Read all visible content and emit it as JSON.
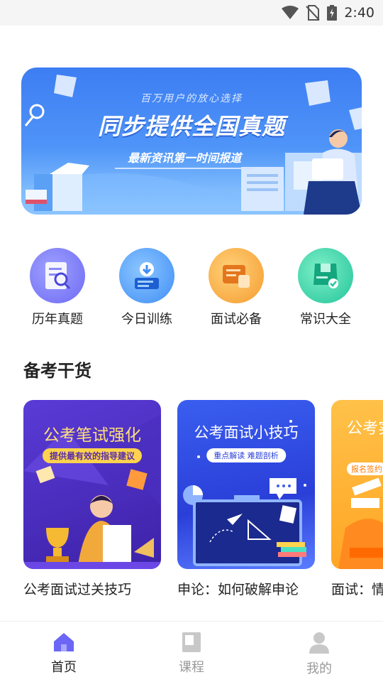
{
  "status_bar": {
    "time": "2:40"
  },
  "banner": {
    "subtitle": "百万用户的放心选择",
    "title": "同步提供全国真题",
    "tagline": "最新资讯第一时间报道"
  },
  "quick_menu": [
    {
      "label": "历年真题",
      "icon": "past-exams-icon",
      "color": "#6f6cf6"
    },
    {
      "label": "今日训练",
      "icon": "daily-training-icon",
      "color": "#3f8ef6"
    },
    {
      "label": "面试必备",
      "icon": "interview-essentials-icon",
      "color": "#f59b2f"
    },
    {
      "label": "常识大全",
      "icon": "common-knowledge-icon",
      "color": "#22c39a"
    }
  ],
  "section": {
    "title": "备考干货"
  },
  "cards": [
    {
      "head": "公考笔试强化",
      "tag": "提供最有效的指导建议",
      "caption": "公考面试过关技巧"
    },
    {
      "head": "公考面试小技巧",
      "tag": "重点解读 难题剖析",
      "caption": "申论：如何破解申论"
    },
    {
      "head": "公考实战",
      "tag": "报名签约",
      "caption": "面试：情"
    }
  ],
  "bottom_nav": [
    {
      "label": "首页",
      "icon": "home-icon",
      "active": true
    },
    {
      "label": "课程",
      "icon": "course-icon",
      "active": false
    },
    {
      "label": "我的",
      "icon": "profile-icon",
      "active": false
    }
  ],
  "colors": {
    "accent": "#6b66f5",
    "inactive": "#999999"
  }
}
